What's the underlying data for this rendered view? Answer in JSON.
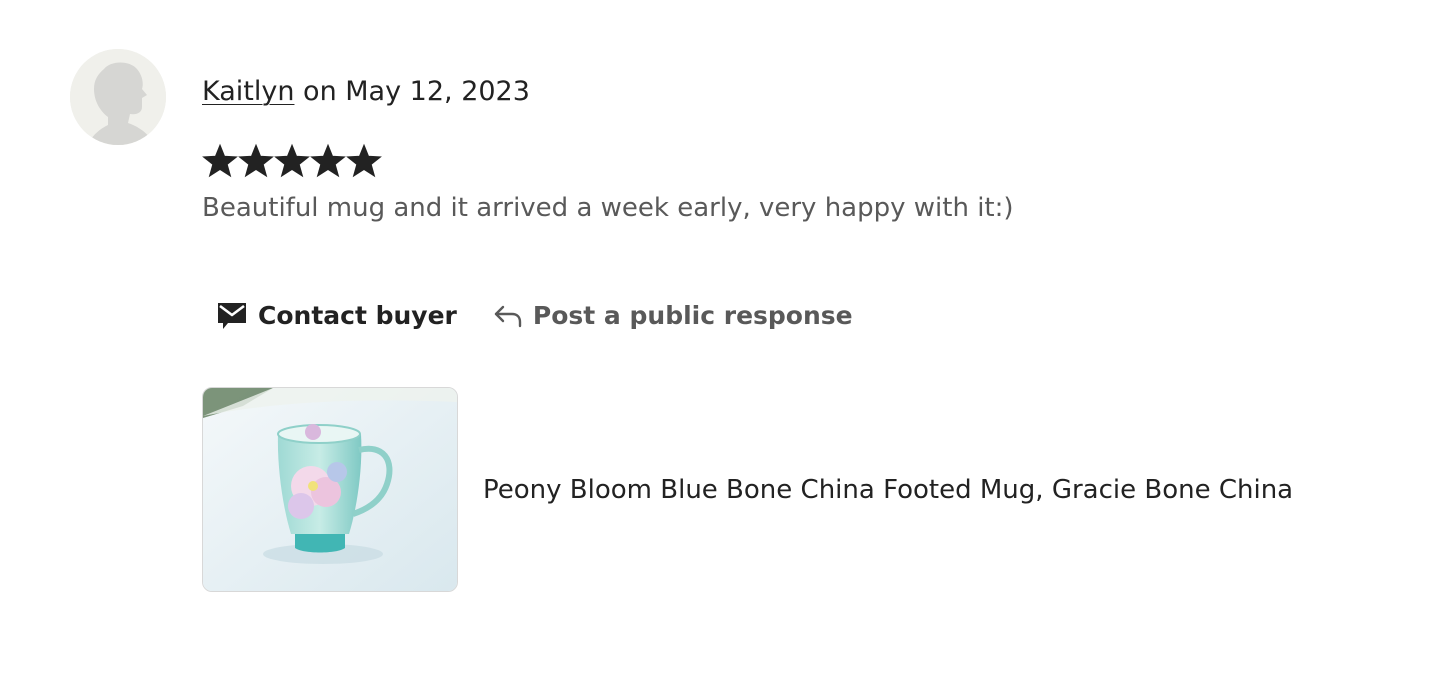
{
  "review": {
    "author": "Kaitlyn",
    "date_text": " on May 12, 2023",
    "rating": 5,
    "rating_max": 5,
    "text": "Beautiful mug and it arrived a week early, very happy with it:)"
  },
  "actions": {
    "contact_label": "Contact buyer",
    "contact_icon": "envelope-icon",
    "respond_label": "Post a public response",
    "respond_icon": "reply-arrow-icon"
  },
  "listing": {
    "title": "Peony Bloom Blue Bone China Footed Mug, Gracie Bone China",
    "image_icon": "mug-photo"
  },
  "colors": {
    "text_primary": "#222222",
    "text_secondary": "#595959",
    "star": "#222222",
    "avatar_bg": "#f0f0eb",
    "avatar_silhouette": "#d6d6d3"
  }
}
